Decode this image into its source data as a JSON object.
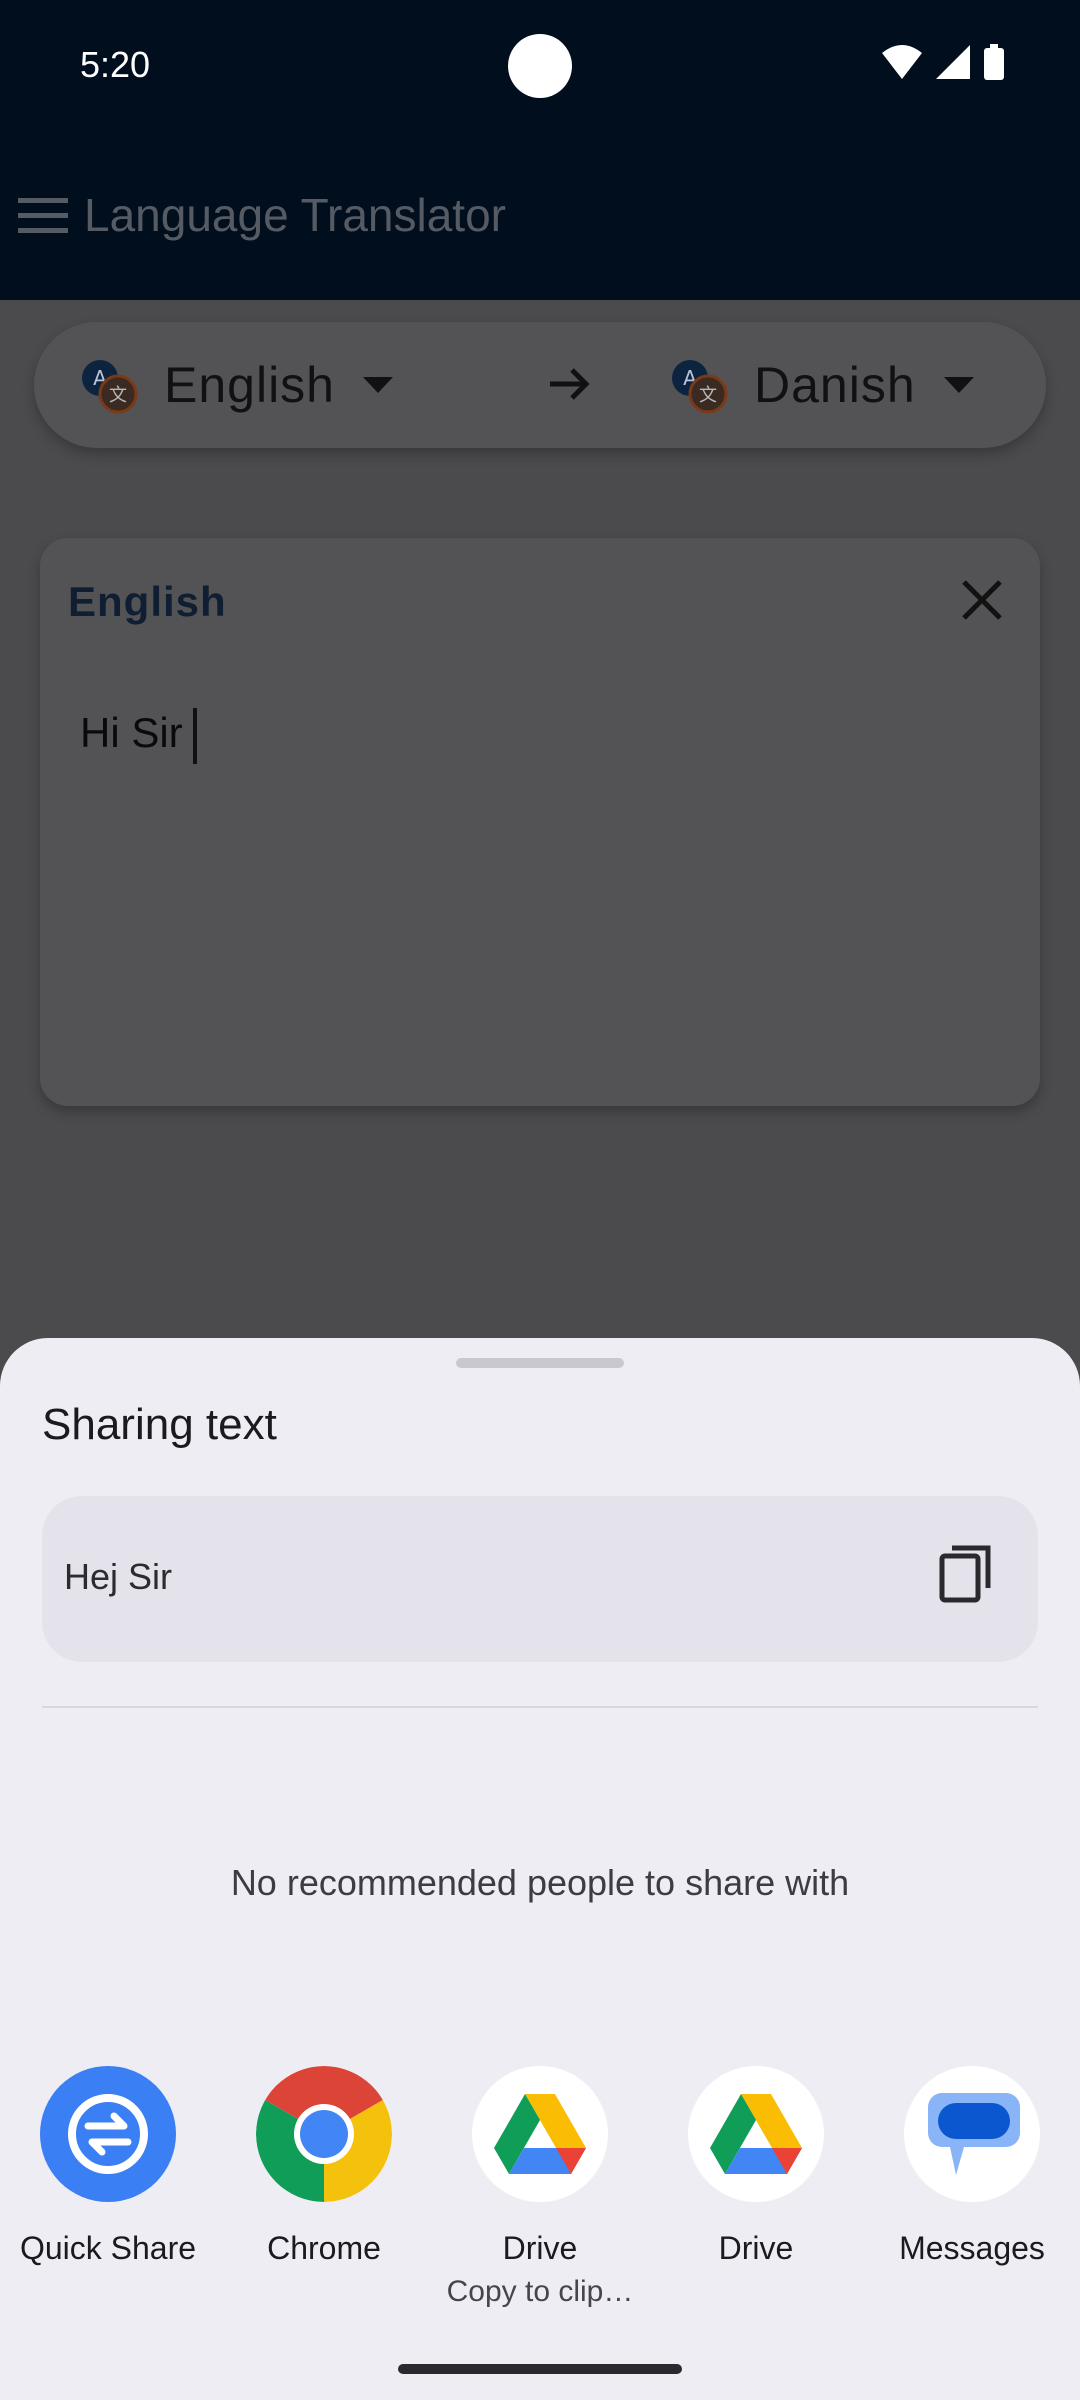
{
  "status": {
    "time": "5:20"
  },
  "app_bar": {
    "title": "Language Translator"
  },
  "language_bar": {
    "source": "English",
    "target": "Danish"
  },
  "input_card": {
    "language_label": "English",
    "text": "Hi Sir"
  },
  "share_sheet": {
    "title": "Sharing text",
    "preview_text": "Hej Sir",
    "no_people_message": "No recommended people to share with",
    "targets": [
      {
        "label": "Quick Share",
        "sub": "",
        "icon": "quick-share-icon"
      },
      {
        "label": "Chrome",
        "sub": "",
        "icon": "chrome-icon"
      },
      {
        "label": "Drive",
        "sub": "Copy to clip…",
        "icon": "drive-icon"
      },
      {
        "label": "Drive",
        "sub": "",
        "icon": "drive-icon"
      },
      {
        "label": "Messages",
        "sub": "",
        "icon": "messages-icon"
      }
    ]
  },
  "colors": {
    "status_bar": "#000e1e",
    "scrim": "#4b4b4d",
    "sheet_bg": "#eeedf3",
    "quick_share_blue": "#3b7ff5",
    "messages_blue": "#0b57d0"
  }
}
